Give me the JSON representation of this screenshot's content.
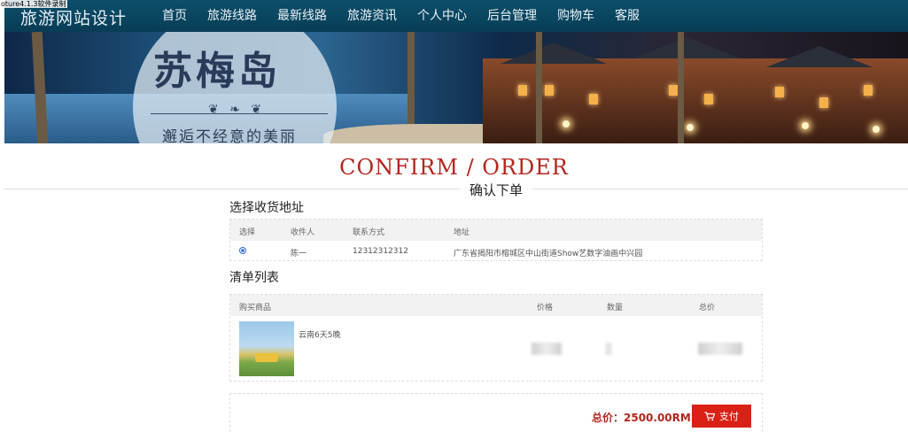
{
  "recorder_label": "oture4.1.3软件录制",
  "brand": "旅游网站设计",
  "nav": [
    "首页",
    "旅游线路",
    "最新线路",
    "旅游资讯",
    "个人中心",
    "后台管理",
    "购物车",
    "客服"
  ],
  "active_nav": "购物车",
  "banner": {
    "title": "苏梅岛",
    "subtitle": "邂逅不经意的美丽",
    "ornament": "❦ ❧ ❦"
  },
  "heading_en": "CONFIRM / ORDER",
  "heading_cn": "确认下单",
  "address_section": {
    "title": "选择收货地址",
    "columns": [
      "选择",
      "收件人",
      "联系方式",
      "地址"
    ],
    "rows": [
      {
        "selected": true,
        "name": "陈一",
        "phone": "12312312312",
        "address": "广东省揭阳市榕城区中山街道Show艺数字油画中兴园"
      }
    ]
  },
  "list_section": {
    "title": "清单列表",
    "columns": [
      "购买商品",
      "价格",
      "数量",
      "总价"
    ],
    "items": [
      {
        "name": "云南6天5晚"
      }
    ]
  },
  "footer": {
    "total": "总价：2500.00RMB",
    "pay_label": "支付"
  },
  "colors": {
    "nav_bg": "#0a4862",
    "accent": "#b3261e",
    "pay_bg": "#d92115"
  },
  "icons": {
    "cart": "cart-icon",
    "radio": "radio-selected-icon"
  }
}
